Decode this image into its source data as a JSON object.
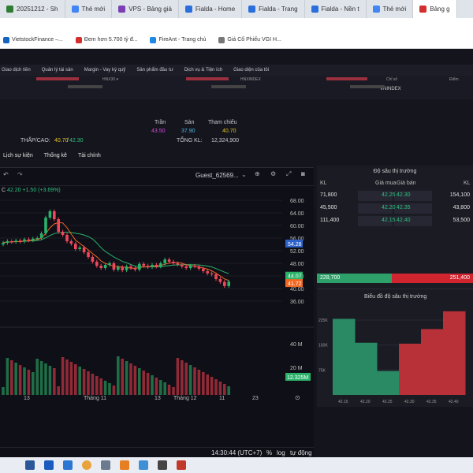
{
  "browser": {
    "tabs": [
      {
        "label": "20251212 - Sh",
        "color": "#2e7d32"
      },
      {
        "label": "Thẻ mới",
        "color": "#4285f4"
      },
      {
        "label": "VPS - Bảng giá",
        "color": "#7b3fb3"
      },
      {
        "label": "Fialda - Home",
        "color": "#2a6fdb"
      },
      {
        "label": "Fialda - Trang",
        "color": "#2a6fdb"
      },
      {
        "label": "Fialda - Nền t",
        "color": "#2a6fdb"
      },
      {
        "label": "Thẻ mới",
        "color": "#4285f4"
      },
      {
        "label": "Bảng g",
        "color": "#d32f2f"
      }
    ],
    "bookmarks": [
      {
        "label": "VietstockFinance –...",
        "color": "#1565c0"
      },
      {
        "label": "Đem hơn 5.700 tỷ đ...",
        "color": "#d32f2f"
      },
      {
        "label": "FireAnt - Trang chủ",
        "color": "#1e88e5"
      },
      {
        "label": "Giá Cổ Phiếu VGI H...",
        "color": "#777777"
      }
    ]
  },
  "menu": [
    "Giao dịch tiền",
    "Quản lý tài sản",
    "Margin - Vay ký quỹ",
    "Sản phẩm đầu tư",
    "Dịch vụ & Tiện ích",
    "Giao diện của tôi"
  ],
  "index_panel": {
    "name": "HNXINDEX",
    "code": "VNINDEX",
    "label": "Chỉ số",
    "point_label": "Điểm"
  },
  "quote": {
    "tran_label": "Trần",
    "tran": "43.50",
    "san_label": "Sàn",
    "san": "37.90",
    "tc_label": "Tham chiếu",
    "tc": "40.70",
    "total_label": "TỔNG KL:",
    "total": "12,324,900",
    "range_label": "THẤP/CAO:",
    "low": "40.70",
    "high": "42.30"
  },
  "tabs": [
    "Lịch sự kiện",
    "Thống kê",
    "Tài chính"
  ],
  "chart": {
    "user": "Guest_62569...",
    "price_label": "42.20",
    "change": "+1.50 (+3.69%)",
    "time": "14:30:44 (UTC+7)",
    "pct_label": "%",
    "log_label": "log",
    "auto_label": "tự động",
    "axis_labels": [
      "68.00",
      "64.00",
      "60.00",
      "56.00",
      "52.00",
      "48.00",
      "44.00",
      "40.00",
      "36.00"
    ],
    "badges": [
      {
        "text": "54.28",
        "color": "#2d62c9"
      },
      {
        "text": "44.07",
        "color": "#2bb26a"
      },
      {
        "text": "42.20",
        "color": "#2bb26a"
      },
      {
        "text": "41.72",
        "color": "#f26722"
      }
    ],
    "vol_labels": [
      "40 M",
      "20 M"
    ],
    "vol_badge": "12.325M",
    "x_labels": [
      "13",
      "Tháng 11",
      "13",
      "Tháng 12",
      "11",
      "23"
    ]
  },
  "depth": {
    "title": "Độ sâu thị trường",
    "headers": {
      "kl": "KL",
      "buy": "Giá mua",
      "sell": "Giá bán",
      "kl2": "KL"
    },
    "rows": [
      {
        "buy_vol": "71,800",
        "buy": "42.25",
        "sell": "42.30",
        "sell_vol": "154,100"
      },
      {
        "buy_vol": "45,500",
        "buy": "42.20",
        "sell": "42.35",
        "sell_vol": "43,800"
      },
      {
        "buy_vol": "111,400",
        "buy": "42.15",
        "sell": "42.40",
        "sell_vol": "53,500"
      }
    ],
    "total_buy": "228,700",
    "total_sell": "251,400"
  },
  "depth_chart": {
    "title": "Biểu đồ độ sâu thị trường",
    "y_labels": [
      "225K",
      "150K",
      "75K"
    ],
    "x_labels": [
      "42.15",
      "42.20",
      "42.25",
      "42.30",
      "42.35",
      "42.40"
    ]
  },
  "chart_data": {
    "type": "area",
    "title": "Biểu đồ độ sâu thị trường",
    "categories": [
      "42.15",
      "42.20",
      "42.25",
      "42.30",
      "42.35",
      "42.40"
    ],
    "series": [
      {
        "name": "",
        "values": [
          228700,
          156900,
          71800,
          0,
          0,
          0
        ]
      },
      {
        "name": "",
        "values": [
          0,
          0,
          0,
          154100,
          197900,
          251400
        ]
      }
    ],
    "ylim": [
      0,
      270000
    ]
  }
}
